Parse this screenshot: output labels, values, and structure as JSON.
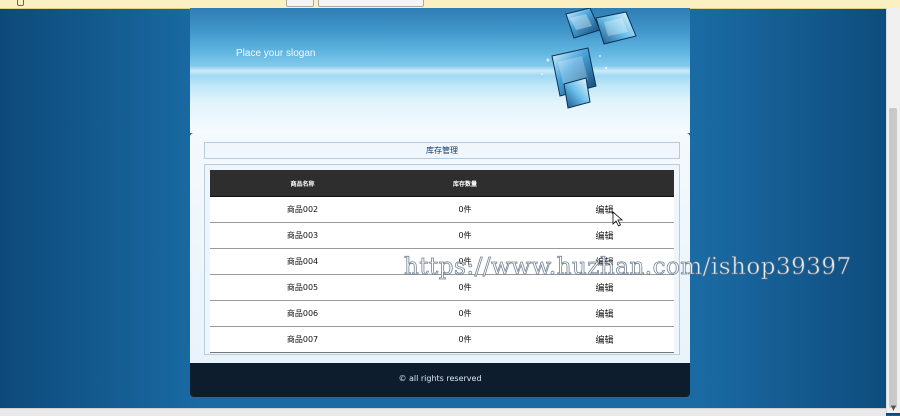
{
  "header": {
    "slogan": "Place your slogan"
  },
  "panel": {
    "title": "库存管理"
  },
  "table": {
    "columns": [
      "商品名称",
      "库存数量",
      ""
    ],
    "rows": [
      {
        "name": "商品002",
        "quantity": "0件",
        "action": "编辑"
      },
      {
        "name": "商品003",
        "quantity": "0件",
        "action": "编辑"
      },
      {
        "name": "商品004",
        "quantity": "0件",
        "action": "编辑"
      },
      {
        "name": "商品005",
        "quantity": "0件",
        "action": "编辑"
      },
      {
        "name": "商品006",
        "quantity": "0件",
        "action": "编辑"
      },
      {
        "name": "商品007",
        "quantity": "0件",
        "action": "编辑"
      }
    ]
  },
  "footer": {
    "copyright": "© all rights reserved"
  },
  "watermark": {
    "text": "https://www.huzhan.com/ishop39397"
  },
  "icons": {
    "cursor": "mouse-pointer-icon",
    "scroll_down": "scroll-down-arrow-icon"
  },
  "colors": {
    "page_background": "#1a5e92",
    "table_header": "#2e2e2e",
    "footer": "#0e1d2e",
    "panel_title": "#0c3b6e"
  }
}
